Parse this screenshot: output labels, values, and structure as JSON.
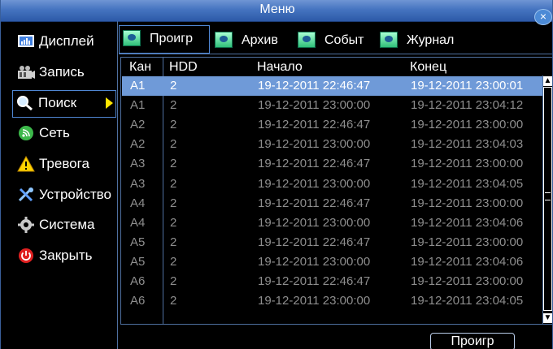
{
  "window": {
    "title": "Меню"
  },
  "sidebar": {
    "items": [
      {
        "label": "Дисплей",
        "icon": "display-icon"
      },
      {
        "label": "Запись",
        "icon": "record-icon"
      },
      {
        "label": "Поиск",
        "icon": "search-icon",
        "active": true
      },
      {
        "label": "Сеть",
        "icon": "network-icon"
      },
      {
        "label": "Тревога",
        "icon": "alarm-icon"
      },
      {
        "label": "Устройство",
        "icon": "device-icon"
      },
      {
        "label": "Система",
        "icon": "system-icon"
      },
      {
        "label": "Закрыть",
        "icon": "power-icon"
      }
    ]
  },
  "tabs": [
    {
      "label": "Проигр",
      "active": true
    },
    {
      "label": "Архив"
    },
    {
      "label": "Событ"
    },
    {
      "label": "Журнал"
    }
  ],
  "table": {
    "headers": [
      "Кан",
      "HDD",
      "Начало",
      "Конец"
    ],
    "rows": [
      [
        "A1",
        "2",
        "19-12-2011 22:46:47",
        "19-12-2011 23:00:01"
      ],
      [
        "A1",
        "2",
        "19-12-2011 23:00:00",
        "19-12-2011 23:04:12"
      ],
      [
        "A2",
        "2",
        "19-12-2011 22:46:47",
        "19-12-2011 23:00:00"
      ],
      [
        "A2",
        "2",
        "19-12-2011 23:00:00",
        "19-12-2011 23:04:03"
      ],
      [
        "A3",
        "2",
        "19-12-2011 22:46:47",
        "19-12-2011 23:00:00"
      ],
      [
        "A3",
        "2",
        "19-12-2011 23:00:00",
        "19-12-2011 23:04:05"
      ],
      [
        "A4",
        "2",
        "19-12-2011 22:46:47",
        "19-12-2011 23:00:00"
      ],
      [
        "A4",
        "2",
        "19-12-2011 23:00:00",
        "19-12-2011 23:04:06"
      ],
      [
        "A5",
        "2",
        "19-12-2011 22:46:47",
        "19-12-2011 23:00:00"
      ],
      [
        "A5",
        "2",
        "19-12-2011 23:00:00",
        "19-12-2011 23:04:06"
      ],
      [
        "A6",
        "2",
        "19-12-2011 22:46:47",
        "19-12-2011 23:00:00"
      ],
      [
        "A6",
        "2",
        "19-12-2011 23:00:00",
        "19-12-2011 23:04:05"
      ]
    ],
    "selected_row": 0
  },
  "footer": {
    "play_label": "Проигр"
  },
  "colors": {
    "accent": "#4f86d2",
    "selected_row": "#6f9ad8",
    "titlebar": "#4574c0",
    "arrow": "#ffe600"
  }
}
